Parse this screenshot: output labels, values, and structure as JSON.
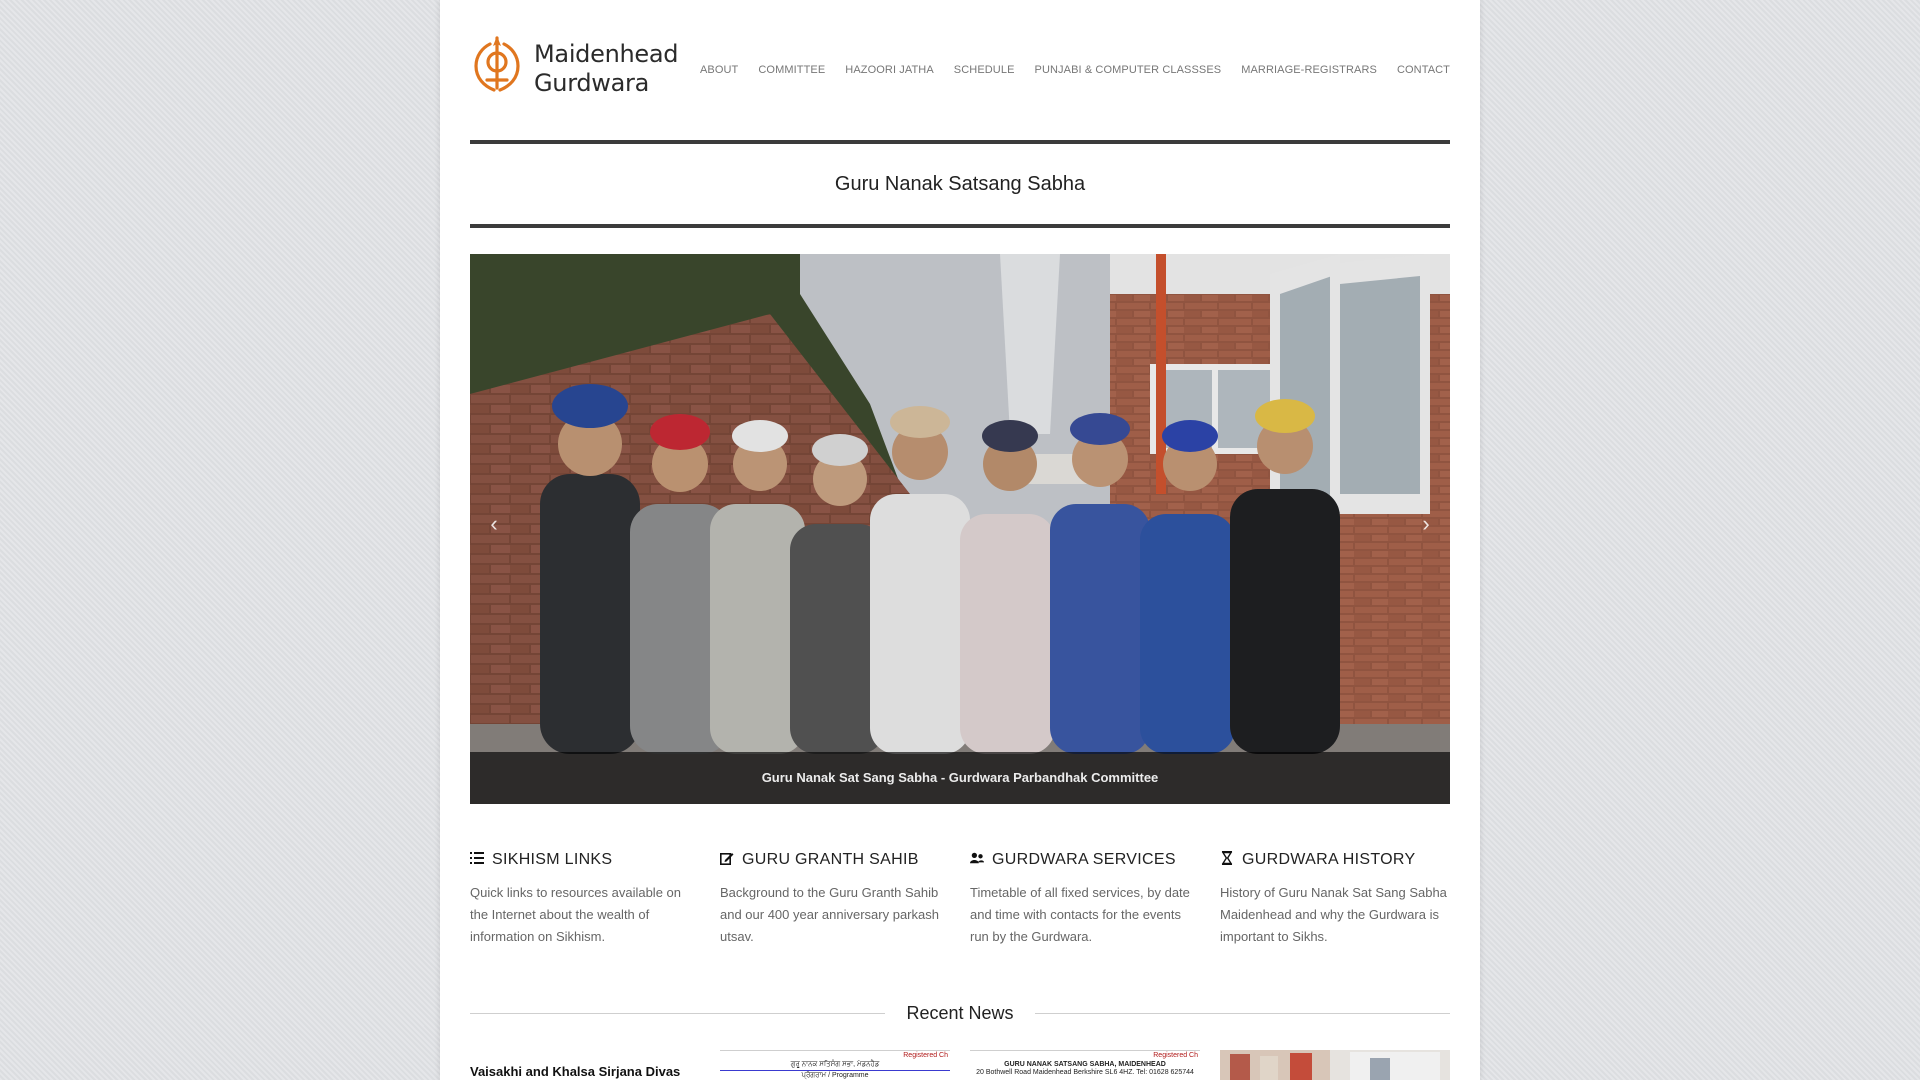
{
  "site": {
    "logo_text_line1": "Maidenhead",
    "logo_text_line2": "Gurdwara",
    "logo_icon": "khanda-icon",
    "brand_color": "#e0761f"
  },
  "nav": {
    "items": [
      {
        "label": "ABOUT"
      },
      {
        "label": "COMMITTEE"
      },
      {
        "label": "HAZOORI JATHA"
      },
      {
        "label": "SCHEDULE"
      },
      {
        "label": "PUNJABI & COMPUTER CLASSSES"
      },
      {
        "label": "MARRIAGE-REGISTRARS"
      },
      {
        "label": "CONTACT"
      }
    ]
  },
  "page_title": "Guru Nanak Satsang Sabha",
  "slider": {
    "caption": "Guru Nanak Sat Sang Sabha - Gurdwara Parbandhak Committee",
    "prev_icon": "chevron-left-icon",
    "next_icon": "chevron-right-icon"
  },
  "features": [
    {
      "icon": "list-icon",
      "title": "SIKHISM LINKS",
      "text": "Quick links to resources available on the Internet about the wealth of information on Sikhism."
    },
    {
      "icon": "edit-icon",
      "title": "GURU GRANTH SAHIB",
      "text": "Background to the Guru Granth Sahib and our 400 year anniversary parkash utsav."
    },
    {
      "icon": "users-icon",
      "title": "GURDWARA SERVICES",
      "text": "Timetable of all fixed services, by date and time with contacts for the events run by the Gurdwara."
    },
    {
      "icon": "hourglass-icon",
      "title": "GURDWARA HISTORY",
      "text": "History of Guru Nanak Sat Sang Sabha Maidenhead and why the Gurdwara is important to Sikhs."
    }
  ],
  "recent_news": {
    "heading": "Recent News",
    "items": [
      {
        "title": "Vaisakhi and Khalsa Sirjana Divas"
      },
      {
        "doc_line1": "Registered Ch",
        "doc_line2": "ਗੁਰੂ ਨਾਨਕ ਸਤਿਸੰਗ ਸਭਾ, ਮੇਡਨਹੈਡ",
        "doc_line3": "ਪ੍ਰੋਗਰਾਮ / Programme"
      },
      {
        "doc_line1": "Registered Ch",
        "doc_line2": "GURU NANAK SATSANG SABHA, MAIDENHEAD",
        "doc_line3": "20 Bothwell Road Maidenhead Berkshire SL6 4HZ. Tel: 01628 625744"
      },
      {
        "image": "news-photo"
      }
    ]
  }
}
